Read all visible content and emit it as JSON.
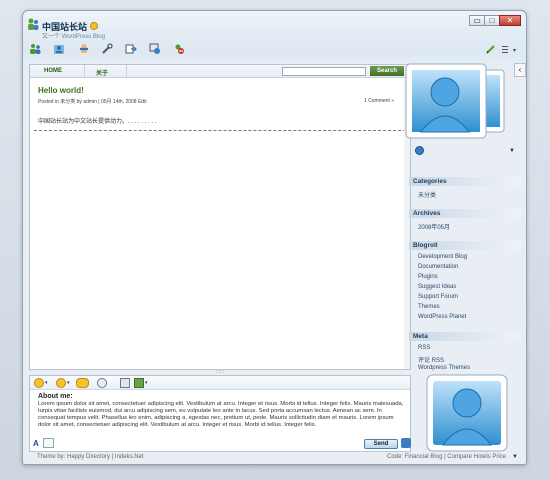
{
  "window": {
    "title": "中国站长站",
    "subtitle": "又一个 WordPress Blog",
    "minimize": "▭",
    "maximize": "□",
    "close": "✕"
  },
  "toolbar": {
    "icons": [
      "users-icon",
      "contacts-icon",
      "hand-icon",
      "tools-icon",
      "share-icon",
      "media-icon",
      "block-icon"
    ],
    "right_icons": [
      "pen-icon",
      "menu-icon"
    ]
  },
  "nav": {
    "home": "HOME",
    "about": "关于",
    "search_placeholder": "",
    "search_button": "Search"
  },
  "post": {
    "title": "Hello world!",
    "meta": "Posted in 未分类  by admin | 05月 14th, 2008 Edit",
    "comments": "1 Comment »",
    "body": "中国站长站为中文站长提供动力。. . . . . . . . ."
  },
  "compose": {
    "about_title": "About me:",
    "about_text": "Lorem ipsum dolor sit amet, consectetuer adipiscing elit. Vestibulum at arcu. Integer et risus. Morbi id tellus. Integer felis. Mauris malesuada, turpis vitae facilisis euismod, dui arcu adipiscing sem, eu vulputate leo ante in lacus. Sed porta accumsan lectus. Aenean ac sem. In consequat tempus velit. Phasellus leo enim, adipiscing a, egestas nec, pretium ut, pede. Mauris sollicitudin diam et mauris. Lorem ipsum dolor sit amet, consectetuer adipiscing elit. Vestibulum at arcu. Integer et risus. Morbi id tellus. Integer felis.",
    "format_a": "A",
    "send": "Send"
  },
  "sidebar": {
    "categories": {
      "title": "Categories",
      "items": [
        "未分类"
      ]
    },
    "archives": {
      "title": "Archives",
      "items": [
        "2008年05月"
      ]
    },
    "blogroll": {
      "title": "Blogroll",
      "items": [
        "Development Blog",
        "Documentation",
        "Plugins",
        "Suggest Ideas",
        "Support Forum",
        "Themes",
        "WordPress Planet"
      ]
    },
    "meta": {
      "title": "Meta",
      "items": [
        "RSS",
        "评论 RSS",
        "Wordpress Themes"
      ]
    },
    "toggle": "‹"
  },
  "status": {
    "left": "Theme by: Happy Directory | Indeks.Net",
    "right": "Code: Financial Blog | Compare Hotels Price",
    "arrow": "▼"
  },
  "colors": {
    "accent_green": "#3c7419",
    "search_button": "#4f7f34",
    "link_blue": "#2b4a69",
    "window_frame": "#8fa3b8"
  }
}
